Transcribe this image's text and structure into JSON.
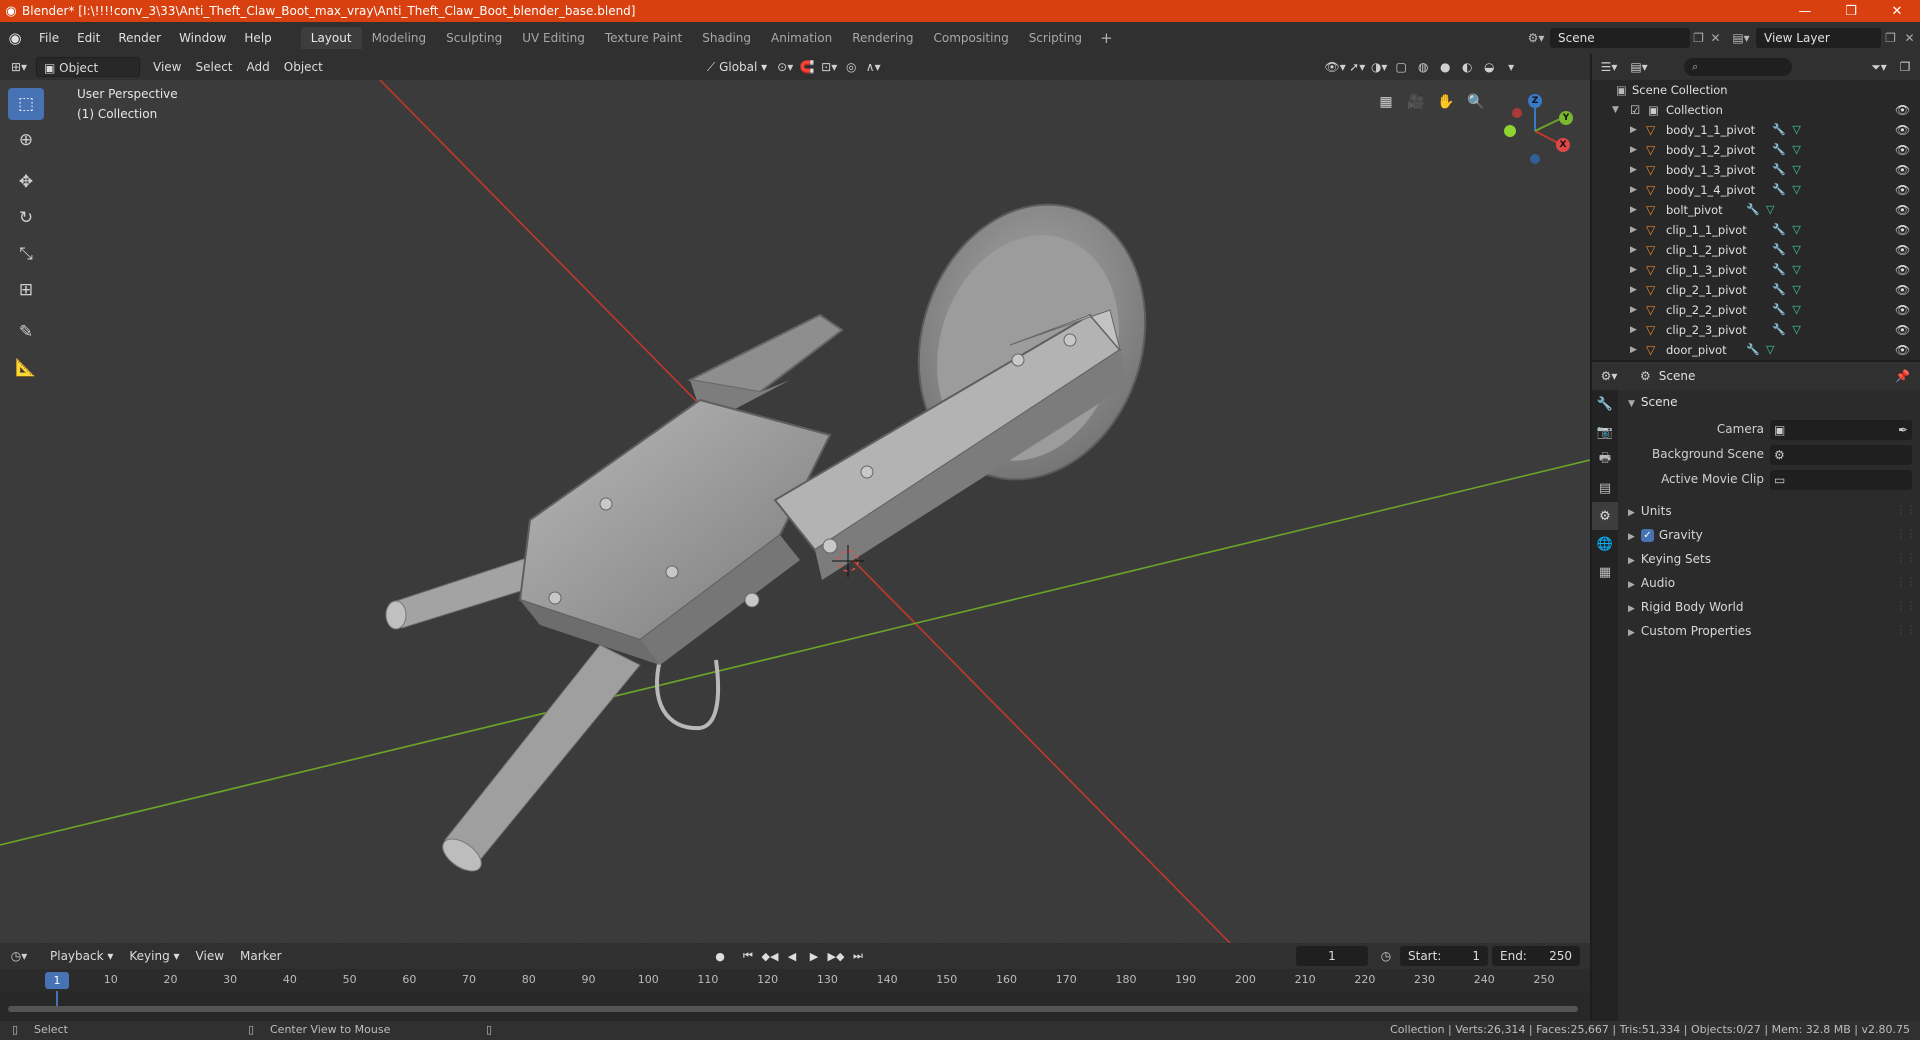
{
  "window": {
    "title": "Blender* [I:\\!!!!conv_3\\33\\Anti_Theft_Claw_Boot_max_vray\\Anti_Theft_Claw_Boot_blender_base.blend]",
    "controls": [
      "—",
      "❐",
      "✕"
    ]
  },
  "menubar": {
    "menus": [
      "File",
      "Edit",
      "Render",
      "Window",
      "Help"
    ],
    "workspaces": [
      "Layout",
      "Modeling",
      "Sculpting",
      "UV Editing",
      "Texture Paint",
      "Shading",
      "Animation",
      "Rendering",
      "Compositing",
      "Scripting"
    ],
    "active_workspace": "Layout",
    "scene": "Scene",
    "view_layer": "View Layer"
  },
  "viewport_header": {
    "mode": "Object Mode",
    "menus": [
      "View",
      "Select",
      "Add",
      "Object"
    ],
    "transform_orientation": "Global"
  },
  "viewport": {
    "perspective_label": "User Perspective",
    "collection_label": "(1) Collection",
    "gizmo_axes": {
      "x": "X",
      "y": "Y",
      "z": "Z"
    }
  },
  "timeline": {
    "menus": [
      "Playback",
      "Keying",
      "View",
      "Marker"
    ],
    "current_frame": "1",
    "start_label": "Start:",
    "start": "1",
    "end_label": "End:",
    "end": "250",
    "ruler": [
      10,
      20,
      30,
      40,
      50,
      60,
      70,
      80,
      90,
      100,
      110,
      120,
      130,
      140,
      150,
      160,
      170,
      180,
      190,
      200,
      210,
      220,
      230,
      240,
      250
    ],
    "cursor_label": "1"
  },
  "statusbar": {
    "left": "Select",
    "middle": "Center View to Mouse",
    "right": "Collection | Verts:26,314 | Faces:25,667 | Tris:51,334 | Objects:0/27 | Mem: 32.8 MB | v2.80.75"
  },
  "outliner": {
    "root": "Scene Collection",
    "collection": "Collection",
    "items": [
      {
        "name": "body_1_1_pivot"
      },
      {
        "name": "body_1_2_pivot"
      },
      {
        "name": "body_1_3_pivot"
      },
      {
        "name": "body_1_4_pivot"
      },
      {
        "name": "bolt_pivot"
      },
      {
        "name": "clip_1_1_pivot"
      },
      {
        "name": "clip_1_2_pivot"
      },
      {
        "name": "clip_1_3_pivot"
      },
      {
        "name": "clip_2_1_pivot"
      },
      {
        "name": "clip_2_2_pivot"
      },
      {
        "name": "clip_2_3_pivot"
      },
      {
        "name": "door_pivot"
      }
    ]
  },
  "properties": {
    "context": "Scene",
    "panel": "Scene",
    "fields": {
      "camera": "Camera",
      "background_scene": "Background Scene",
      "active_movie_clip": "Active Movie Clip"
    },
    "subpanels": {
      "units": "Units",
      "gravity": "Gravity",
      "keying_sets": "Keying Sets",
      "audio": "Audio",
      "rigid_body_world": "Rigid Body World",
      "custom_properties": "Custom Properties"
    },
    "gravity_enabled": true
  },
  "colors": {
    "titlebar": "#d8410f",
    "accent": "#4772b3",
    "axis_x": "#c0392b",
    "axis_y": "#6aa329"
  }
}
